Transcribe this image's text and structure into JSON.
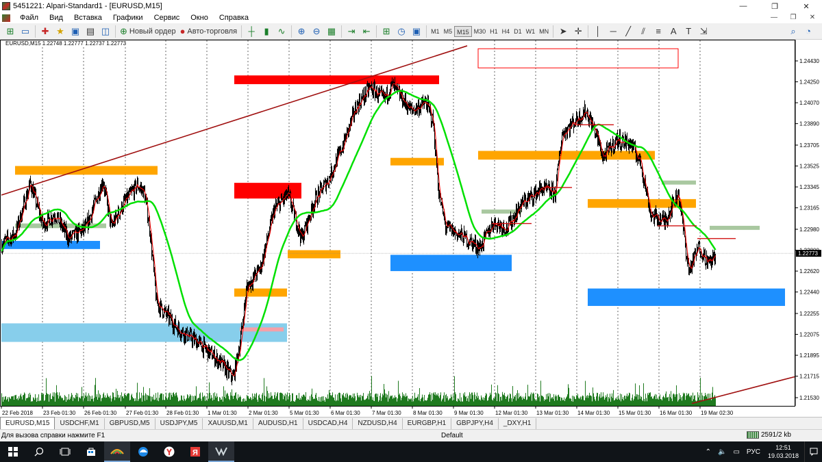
{
  "window": {
    "title": "5451221: Alpari-Standard1 - [EURUSD,M15]",
    "minimize_glyph": "—",
    "restore_glyph": "❐",
    "close_glyph": "✕"
  },
  "menu": {
    "items": [
      "Файл",
      "Вид",
      "Вставка",
      "Графики",
      "Сервис",
      "Окно",
      "Справка"
    ],
    "right_controls": [
      "—",
      "❐",
      "✕"
    ]
  },
  "toolbar": {
    "new_order_label": "Новый ордер",
    "autotrading_label": "Авто-торговля",
    "timeframes": [
      "M1",
      "M5",
      "M15",
      "M30",
      "H1",
      "H4",
      "D1",
      "W1",
      "MN"
    ],
    "active_timeframe": "M15",
    "icons": [
      "new-chart-icon",
      "profiles-icon",
      "market-watch-icon",
      "navigator-icon",
      "data-window-icon",
      "terminal-icon",
      "tester-icon",
      "new-order-icon",
      "autotrading-icon",
      "bar-chart-icon",
      "candlestick-icon",
      "line-chart-icon",
      "zoom-in-icon",
      "zoom-out-icon",
      "tile-icon",
      "autoscroll-icon",
      "chart-shift-icon",
      "indicators-icon",
      "periods-icon",
      "templates-icon",
      "cursor-icon",
      "crosshair-icon",
      "vertical-line-icon",
      "horizontal-line-icon",
      "trendline-icon",
      "channel-icon",
      "fibonacci-icon",
      "text-icon",
      "text-label-icon",
      "arrows-icon",
      "search-icon",
      "community-icon"
    ]
  },
  "chart": {
    "symbol_info": "EURUSD,M15  1.22748 1.22777 1.22737 1.22773",
    "current_price": "1.22773",
    "colors": {
      "up": "#000000",
      "ma_fast": "#ff0000",
      "ma_slow": "#00e000",
      "trendline": "#a01010",
      "volume": "#1f7a1f",
      "zone_red": "#ff0000",
      "zone_orange": "#ffa500",
      "zone_blue": "#1e90ff",
      "zone_lightblue": "#87ceeb",
      "zone_gray": "#a9c8a0"
    }
  },
  "chart_data": {
    "type": "candlestick",
    "symbol": "EURUSD",
    "timeframe": "M15",
    "y_ticks": [
      "1.24430",
      "1.24250",
      "1.24070",
      "1.23890",
      "1.23705",
      "1.23525",
      "1.23345",
      "1.23165",
      "1.22980",
      "1.22800",
      "1.22620",
      "1.22440",
      "1.22255",
      "1.22075",
      "1.21895",
      "1.21715",
      "1.21530"
    ],
    "ylim": [
      1.2153,
      1.2459
    ],
    "x_ticks": [
      "22 Feb 2018",
      "23 Feb 01:30",
      "26 Feb 01:30",
      "27 Feb 01:30",
      "28 Feb 01:30",
      "1 Mar 01:30",
      "2 Mar 01:30",
      "5 Mar 01:30",
      "6 Mar 01:30",
      "7 Mar 01:30",
      "8 Mar 01:30",
      "9 Mar 01:30",
      "12 Mar 01:30",
      "13 Mar 01:30",
      "14 Mar 01:30",
      "15 Mar 01:30",
      "16 Mar 01:30",
      "19 Mar 02:30"
    ],
    "price_path": [
      [
        1.2285,
        2
      ],
      [
        1.2294,
        22
      ],
      [
        1.2338,
        44
      ],
      [
        1.2302,
        62
      ],
      [
        1.2311,
        80
      ],
      [
        1.229,
        100
      ],
      [
        1.2299,
        125
      ],
      [
        1.234,
        150
      ],
      [
        1.23,
        162
      ],
      [
        1.232,
        180
      ],
      [
        1.2336,
        200
      ],
      [
        1.233,
        210
      ],
      [
        1.23,
        218
      ],
      [
        1.2235,
        228
      ],
      [
        1.2212,
        260
      ],
      [
        1.22,
        290
      ],
      [
        1.2184,
        320
      ],
      [
        1.217,
        340
      ],
      [
        1.22,
        350
      ],
      [
        1.2248,
        360
      ],
      [
        1.2265,
        380
      ],
      [
        1.2315,
        400
      ],
      [
        1.2328,
        420
      ],
      [
        1.229,
        440
      ],
      [
        1.2324,
        460
      ],
      [
        1.2342,
        480
      ],
      [
        1.237,
        500
      ],
      [
        1.2404,
        520
      ],
      [
        1.242,
        540
      ],
      [
        1.241,
        560
      ],
      [
        1.2422,
        572
      ],
      [
        1.24,
        600
      ],
      [
        1.2407,
        622
      ],
      [
        1.239,
        632
      ],
      [
        1.233,
        640
      ],
      [
        1.23,
        650
      ],
      [
        1.229,
        680
      ],
      [
        1.2282,
        700
      ],
      [
        1.2304,
        720
      ],
      [
        1.2299,
        740
      ],
      [
        1.2319,
        760
      ],
      [
        1.2333,
        790
      ],
      [
        1.2329,
        810
      ],
      [
        1.238,
        820
      ],
      [
        1.2392,
        840
      ],
      [
        1.24,
        855
      ],
      [
        1.238,
        870
      ],
      [
        1.236,
        880
      ],
      [
        1.2375,
        900
      ],
      [
        1.2372,
        920
      ],
      [
        1.2355,
        935
      ],
      [
        1.231,
        950
      ],
      [
        1.2305,
        970
      ],
      [
        1.233,
        990
      ],
      [
        1.2262,
        1005
      ],
      [
        1.2283,
        1020
      ],
      [
        1.2268,
        1035
      ],
      [
        1.2277,
        1044
      ]
    ],
    "zones": [
      {
        "color": "zone_red",
        "outline": true,
        "x1": 698,
        "x2": 990,
        "y1": 1.24535,
        "y2": 1.2437
      },
      {
        "color": "zone_red",
        "x1": 342,
        "x2": 641,
        "y1": 1.24305,
        "y2": 1.2423
      },
      {
        "color": "zone_orange",
        "x1": 22,
        "x2": 230,
        "y1": 1.23525,
        "y2": 1.2345
      },
      {
        "color": "zone_red",
        "x1": 342,
        "x2": 440,
        "y1": 1.2338,
        "y2": 1.23245
      },
      {
        "color": "zone_orange",
        "x1": 570,
        "x2": 648,
        "y1": 1.23595,
        "y2": 1.2353
      },
      {
        "color": "zone_orange",
        "x1": 698,
        "x2": 956,
        "y1": 1.23655,
        "y2": 1.2358
      },
      {
        "color": "zone_orange",
        "x1": 858,
        "x2": 1016,
        "y1": 1.2324,
        "y2": 1.23165
      },
      {
        "color": "zone_blue",
        "x1": 2,
        "x2": 146,
        "y1": 1.2288,
        "y2": 1.2281
      },
      {
        "color": "zone_orange",
        "x1": 420,
        "x2": 497,
        "y1": 1.228,
        "y2": 1.2273
      },
      {
        "color": "zone_blue",
        "x1": 570,
        "x2": 747,
        "y1": 1.2276,
        "y2": 1.2262
      },
      {
        "color": "zone_orange",
        "x1": 342,
        "x2": 419,
        "y1": 1.2247,
        "y2": 1.224
      },
      {
        "color": "zone_blue",
        "x1": 858,
        "x2": 1146,
        "y1": 1.2247,
        "y2": 1.2232
      },
      {
        "color": "zone_lightblue",
        "x1": 2,
        "x2": 419,
        "y1": 1.2217,
        "y2": 1.2201
      },
      {
        "color": "zone_gray",
        "x1": 22,
        "x2": 155,
        "y1": 1.2303,
        "y2": 1.2299
      },
      {
        "color": "zone_gray",
        "x1": 966,
        "x2": 1016,
        "y1": 1.234,
        "y2": 1.23365
      },
      {
        "color": "zone_gray",
        "x1": 1036,
        "x2": 1109,
        "y1": 1.2301,
        "y2": 1.22975
      },
      {
        "color": "zone_gray",
        "x1": 703,
        "x2": 761,
        "y1": 1.2315,
        "y2": 1.23115
      },
      {
        "color": "zone_pink",
        "x1": 350,
        "x2": 414,
        "y1": 1.22135,
        "y2": 1.221
      }
    ],
    "levels": [
      {
        "price": 1.2388,
        "x1": 838,
        "x2": 896
      },
      {
        "price": 1.2334,
        "x1": 792,
        "x2": 835
      },
      {
        "price": 1.2303,
        "x1": 718,
        "x2": 776
      },
      {
        "price": 1.2301,
        "x1": 960,
        "x2": 1017
      },
      {
        "price": 1.229,
        "x1": 1018,
        "x2": 1074
      }
    ],
    "trendlines": [
      {
        "x1": 2,
        "p1": 1.23275,
        "x2": 682,
        "p2": 1.2456
      },
      {
        "x1": 1010,
        "p1": 1.2148,
        "x2": 1160,
        "p2": 1.2171
      }
    ]
  },
  "tabs": {
    "items": [
      "EURUSD,M15",
      "USDCHF,M1",
      "GBPUSD,M5",
      "USDJPY,M5",
      "XAUUSD,M1",
      "AUDUSD,H1",
      "USDCAD,H4",
      "NZDUSD,H4",
      "EURGBP,H1",
      "GBPJPY,H4",
      "_DXY,H1"
    ],
    "active": "EURUSD,M15"
  },
  "status": {
    "help_text": "Для вызова справки нажмите F1",
    "profile": "Default",
    "connection": "2591/2 kb"
  },
  "taskbar": {
    "apps": [
      "windows-start-icon",
      "search-icon",
      "task-view-icon",
      "store-icon",
      "alpari-app-icon",
      "edge-icon",
      "yandex-browser-icon",
      "yandex-icon",
      "metatrader-icon"
    ],
    "lang": "РУС",
    "time": "12:51",
    "date": "19.03.2018"
  }
}
